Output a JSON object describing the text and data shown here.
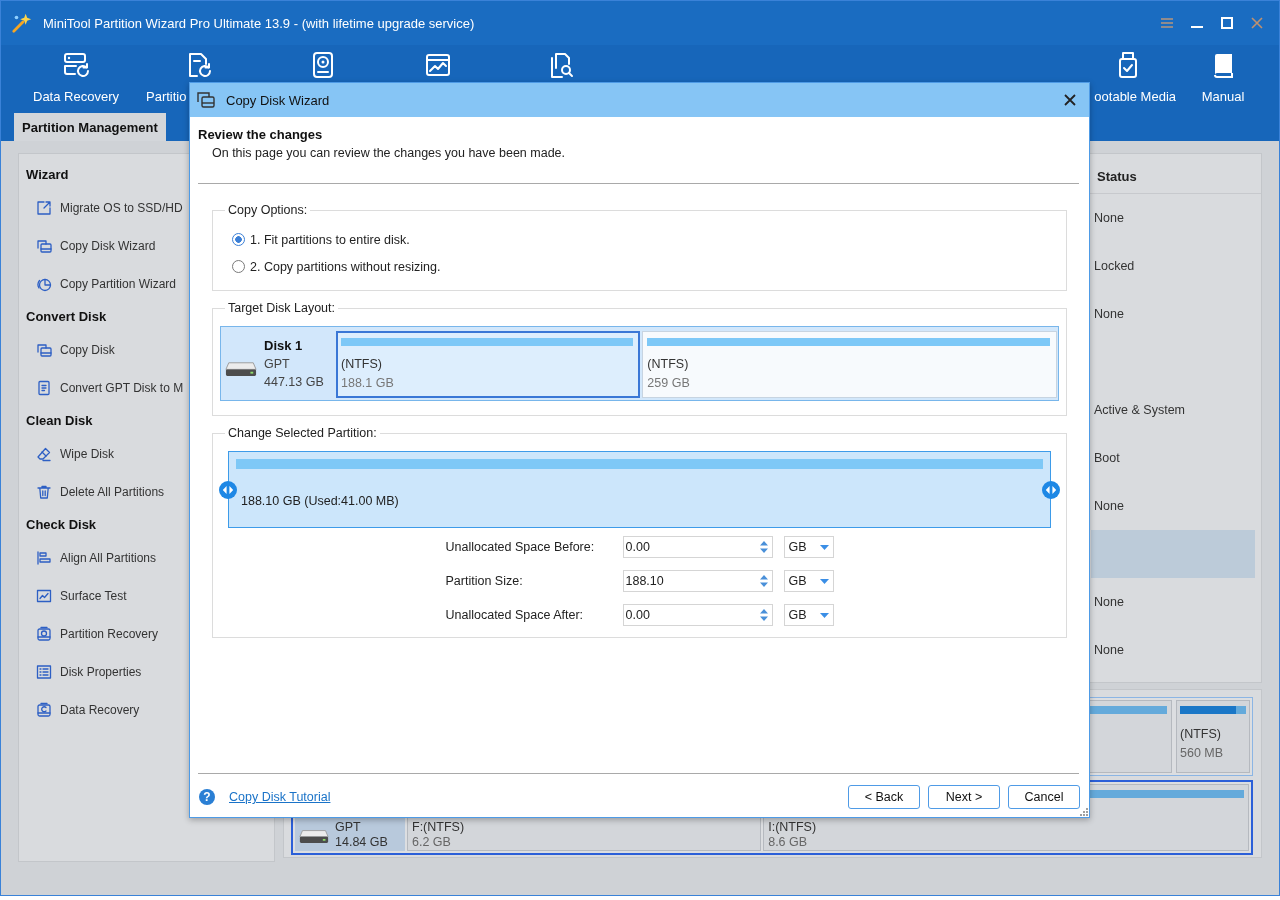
{
  "window": {
    "title": "MiniTool Partition Wizard Pro Ultimate 13.9 - (with lifetime upgrade service)"
  },
  "toolbar": [
    {
      "kind": "recovery",
      "label": "Data Recovery"
    },
    {
      "kind": "restore",
      "label": "Partitio"
    },
    {
      "kind": "benchmark"
    },
    {
      "kind": "analyzer"
    },
    {
      "kind": "files"
    },
    {
      "kind": "usb",
      "label": "ootable Media"
    },
    {
      "kind": "book",
      "label": "Manual"
    }
  ],
  "tabs": [
    {
      "label": "Partition Management",
      "selected": true
    }
  ],
  "sidebar": {
    "sections": [
      {
        "title": "Wizard",
        "items": [
          {
            "kind": "migrate",
            "label": "Migrate OS to SSD/HD"
          },
          {
            "kind": "copydisk",
            "label": "Copy Disk Wizard"
          },
          {
            "kind": "copypartition",
            "label": "Copy Partition Wizard"
          }
        ]
      },
      {
        "title": "Convert Disk",
        "items": [
          {
            "kind": "copydisk",
            "label": "Copy Disk"
          },
          {
            "kind": "convert",
            "label": "Convert GPT Disk to M"
          }
        ]
      },
      {
        "title": "Clean Disk",
        "items": [
          {
            "kind": "wipe",
            "label": "Wipe Disk"
          },
          {
            "kind": "delete",
            "label": "Delete All Partitions"
          }
        ]
      },
      {
        "title": "Check Disk",
        "items": [
          {
            "kind": "align",
            "label": "Align All Partitions"
          },
          {
            "kind": "surface",
            "label": "Surface Test"
          },
          {
            "kind": "restore",
            "label": "Partition Recovery"
          },
          {
            "kind": "properties",
            "label": "Disk Properties"
          },
          {
            "kind": "recovery",
            "label": "Data Recovery"
          }
        ]
      }
    ]
  },
  "partition_table": {
    "columns": [
      "Status"
    ],
    "rows": [
      {
        "status": "None",
        "selected": false
      },
      {
        "status": "Locked",
        "selected": false
      },
      {
        "status": "None",
        "selected": false
      },
      {
        "selected": false
      },
      {
        "status": "Active & System",
        "selected": false
      },
      {
        "status": "Boot",
        "selected": false
      },
      {
        "status": "None",
        "selected": false
      },
      {
        "selected": true
      },
      {
        "status": "None",
        "selected": false
      },
      {
        "status": "None",
        "selected": false
      }
    ]
  },
  "disk_map": {
    "disks": [
      {
        "selected": false,
        "partitions": [
          {
            "selected": false
          },
          {
            "label": "(NTFS)",
            "size": "560 MB",
            "level": 0.85,
            "selected": false
          }
        ]
      },
      {
        "selected": true,
        "type": "GPT",
        "capacity": "14.84 GB",
        "partitions": [
          {
            "label": "F:(NTFS)",
            "size": "6.2 GB",
            "selected": false
          },
          {
            "label": "I:(NTFS)",
            "size": "8.6 GB",
            "selected": false
          }
        ]
      }
    ]
  },
  "dialog": {
    "title": "Copy Disk Wizard",
    "heading": "Review the changes",
    "description": "On this page you can review the changes you have been made.",
    "copy_options": {
      "title": "Copy Options:",
      "options": [
        {
          "label": "1. Fit partitions to entire disk.",
          "selected": true
        },
        {
          "label": "2. Copy partitions without resizing.",
          "selected": false
        }
      ]
    },
    "target_disk_layout": {
      "title": "Target Disk Layout:",
      "disk": {
        "name": "Disk 1",
        "type": "GPT",
        "capacity": "447.13 GB"
      },
      "partitions": [
        {
          "label": "(NTFS)",
          "size": "188.1 GB",
          "selected": true
        },
        {
          "label": "(NTFS)",
          "size": "259 GB",
          "selected": false
        }
      ]
    },
    "change_selected_partition": {
      "title": "Change Selected Partition:",
      "summary": "188.10 GB (Used:41.00 MB)",
      "fields": [
        {
          "label": "Unallocated Space Before:",
          "value": "0.00",
          "unit": "GB"
        },
        {
          "label": "Partition Size:",
          "value": "188.10",
          "unit": "GB"
        },
        {
          "label": "Unallocated Space After:",
          "value": "0.00",
          "unit": "GB"
        }
      ]
    },
    "help": {
      "icon": "?",
      "link": "Copy Disk Tutorial"
    },
    "buttons": [
      "< Back",
      "Next >",
      "Cancel"
    ]
  }
}
